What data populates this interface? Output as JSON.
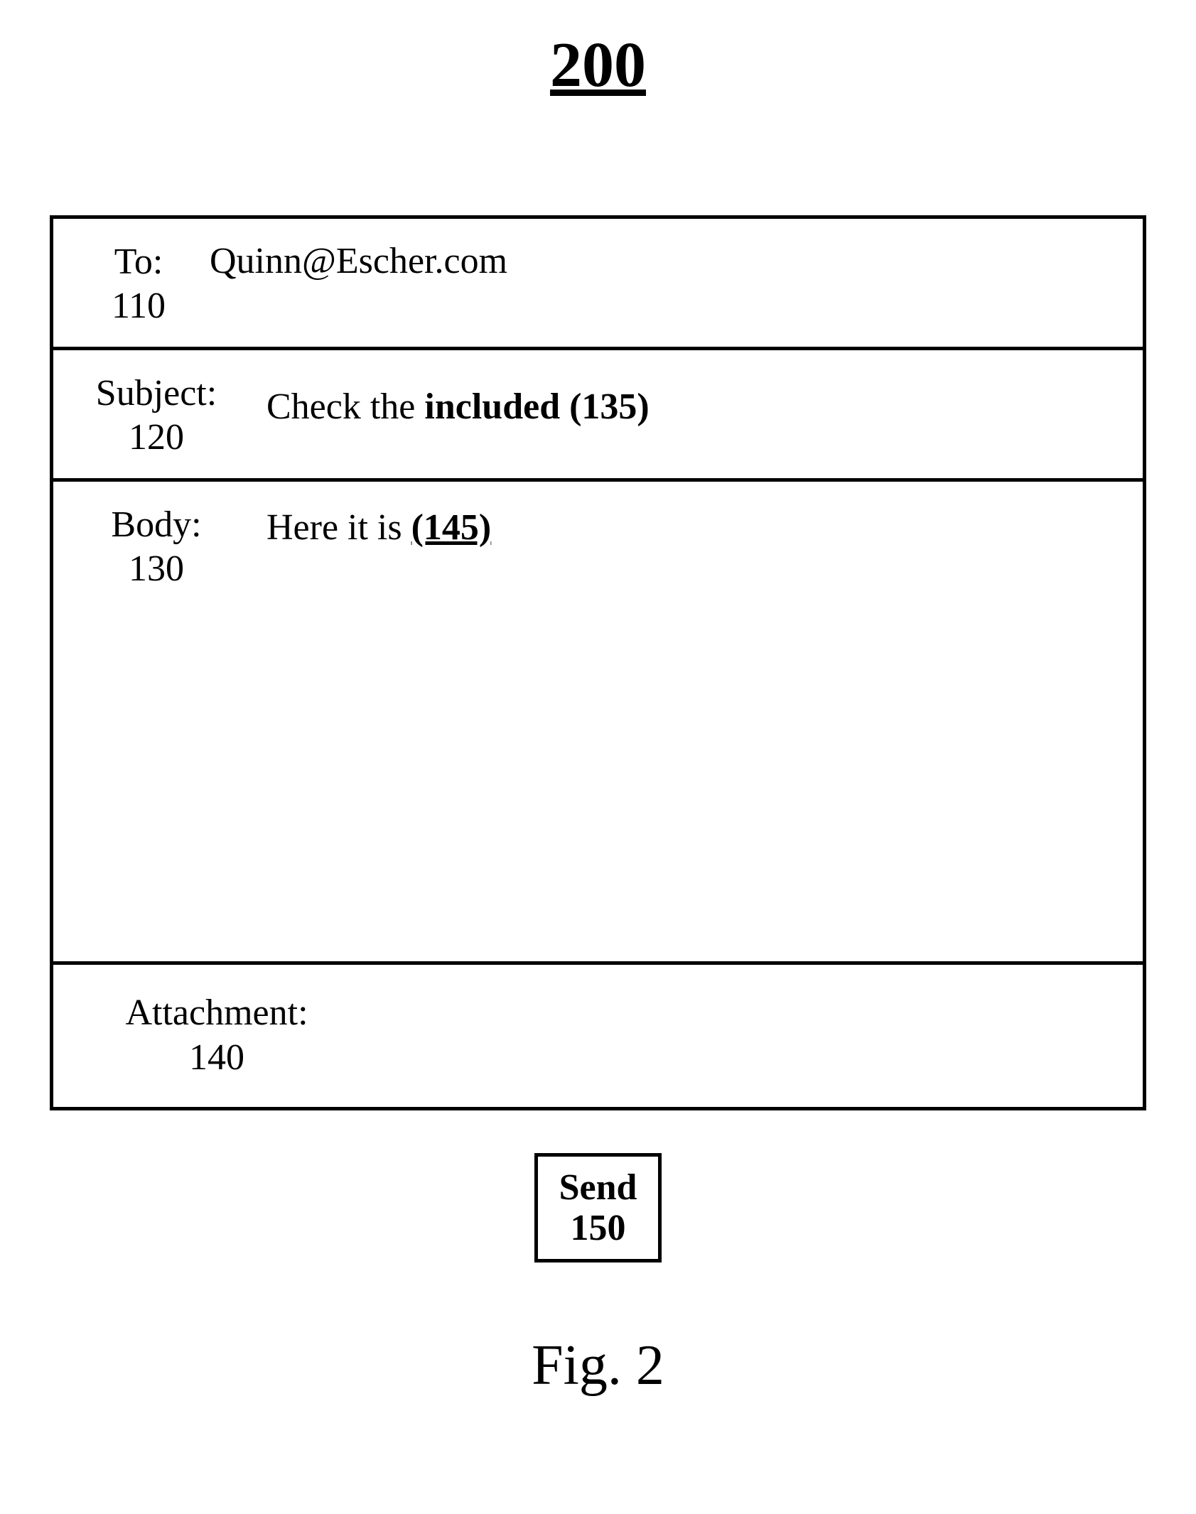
{
  "figure": {
    "number": "200",
    "caption": "Fig. 2"
  },
  "fields": {
    "to": {
      "label": "To:",
      "ref": "110",
      "value": "Quinn@Escher.com"
    },
    "subject": {
      "label": "Subject:",
      "ref": "120",
      "prefix": "Check the ",
      "bold": "included (135)"
    },
    "body": {
      "label": "Body:",
      "ref": "130",
      "prefix": "Here it is ",
      "bold": "(145)"
    },
    "attachment": {
      "label": "Attachment:",
      "ref": "140"
    }
  },
  "send": {
    "label": "Send",
    "ref": "150"
  }
}
